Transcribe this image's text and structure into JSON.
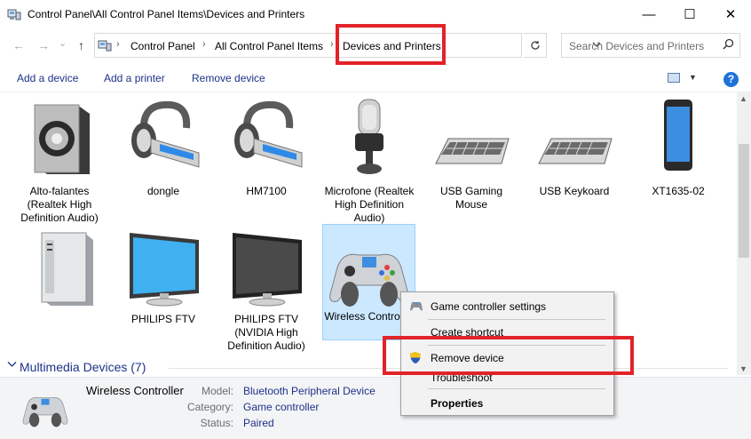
{
  "window": {
    "title": "Control Panel\\All Control Panel Items\\Devices and Printers",
    "minimize": "—",
    "maximize": "☐",
    "close": "✕"
  },
  "nav": {
    "back": "←",
    "forward": "→",
    "history": "⌄",
    "up": "↑"
  },
  "breadcrumb": [
    "Control Panel",
    "All Control Panel Items",
    "Devices and Printers"
  ],
  "breadcrumb_sep": "›",
  "search": {
    "placeholder": "Search Devices and Printers"
  },
  "toolbar": {
    "add_device": "Add a device",
    "add_printer": "Add a printer",
    "remove_device": "Remove device",
    "help": "?"
  },
  "devices": [
    {
      "label": "Alto-falantes (Realtek High Definition Audio)",
      "icon": "speaker-icon"
    },
    {
      "label": "dongle",
      "icon": "headset-icon"
    },
    {
      "label": "HM7100",
      "icon": "headset-icon"
    },
    {
      "label": "Microfone (Realtek High Definition Audio)",
      "icon": "microphone-icon"
    },
    {
      "label": "USB Gaming Mouse",
      "icon": "keyboard-icon"
    },
    {
      "label": "USB Keykoard",
      "icon": "keyboard-icon"
    },
    {
      "label": "XT1635-02",
      "icon": "phone-icon"
    },
    {
      "label": "",
      "icon": "computer-tower-icon"
    },
    {
      "label": "PHILIPS FTV",
      "icon": "monitor-icon"
    },
    {
      "label": "PHILIPS FTV (NVIDIA High Definition Audio)",
      "icon": "tv-icon"
    },
    {
      "label": "Wireless Controller",
      "icon": "gamepad-icon"
    }
  ],
  "group": {
    "label": "Multimedia Devices (7)"
  },
  "details": {
    "name": "Wireless Controller",
    "model_key": "Model:",
    "model": "Bluetooth Peripheral Device",
    "category_key": "Category:",
    "category": "Game controller",
    "status_key": "Status:",
    "status": "Paired"
  },
  "context_menu": {
    "game_controller_settings": "Game controller settings",
    "create_shortcut": "Create shortcut",
    "remove_device": "Remove device",
    "troubleshoot": "Troubleshoot",
    "properties": "Properties"
  },
  "colors": {
    "highlight_box": "#e2232a",
    "selection": "#cce8ff",
    "link_blue": "#1e3287"
  }
}
